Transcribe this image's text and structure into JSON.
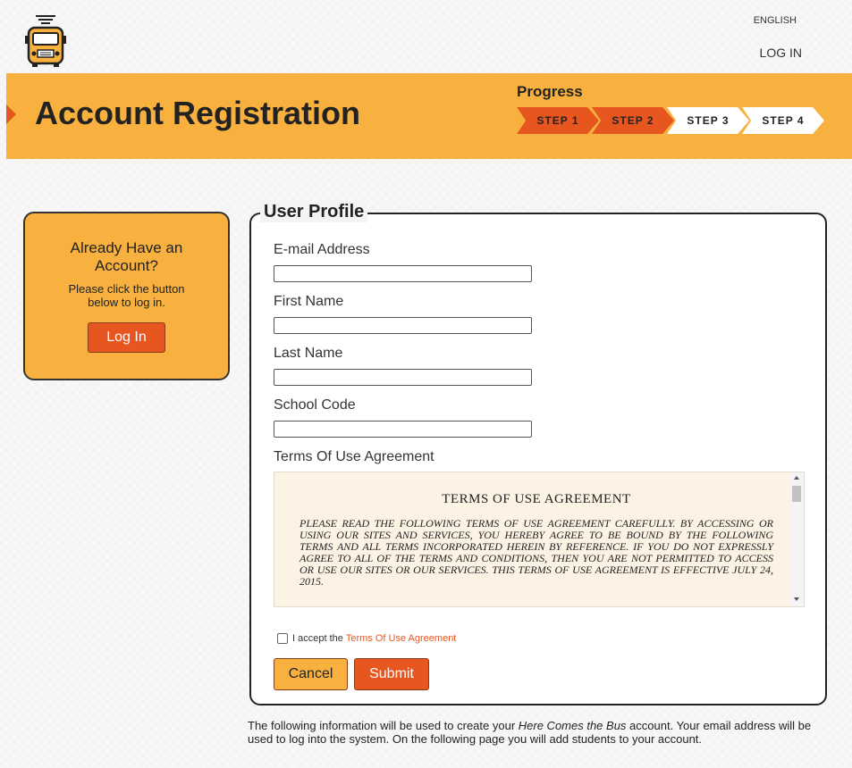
{
  "header": {
    "language": "ENGLISH",
    "login_link": "LOG IN"
  },
  "banner": {
    "title": "Account Registration",
    "progress_label": "Progress",
    "steps": [
      {
        "label": "STEP 1",
        "status": "done"
      },
      {
        "label": "STEP 2",
        "status": "done"
      },
      {
        "label": "STEP 3",
        "status": "todo"
      },
      {
        "label": "STEP 4",
        "status": "todo"
      }
    ]
  },
  "sidebox": {
    "heading": "Already Have an Account?",
    "text": "Please click the button below to log in.",
    "button": "Log In"
  },
  "form": {
    "legend": "User Profile",
    "fields": {
      "email": {
        "label": "E-mail Address",
        "value": ""
      },
      "first_name": {
        "label": "First Name",
        "value": ""
      },
      "last_name": {
        "label": "Last Name",
        "value": ""
      },
      "school_code": {
        "label": "School Code",
        "value": ""
      }
    },
    "terms_label": "Terms Of Use Agreement",
    "terms": {
      "title": "TERMS OF USE AGREEMENT",
      "body": "PLEASE READ THE FOLLOWING TERMS OF USE AGREEMENT CAREFULLY.  BY ACCESSING OR USING OUR SITES AND SERVICES, YOU HEREBY AGREE TO BE BOUND BY THE FOLLOWING TERMS AND ALL TERMS INCORPORATED HEREIN BY REFERENCE.  IF YOU DO NOT EXPRESSLY AGREE TO ALL OF THE TERMS AND CONDITIONS, THEN YOU ARE NOT PERMITTED TO ACCESS OR USE OUR SITES OR OUR SERVICES.  THIS TERMS OF USE AGREEMENT IS EFFECTIVE JULY 24, 2015."
    },
    "accept_prefix": "I accept the",
    "accept_link": "Terms Of Use Agreement",
    "cancel": "Cancel",
    "submit": "Submit"
  },
  "footer": {
    "before": "The following information will be used to create your ",
    "brand": "Here Comes the Bus",
    "after": " account. Your email address will be used to log into the system. On the following page you will add students to your account."
  },
  "colors": {
    "accent_orange": "#e8561f",
    "banner_yellow": "#f8b13e"
  },
  "icons": {
    "logo": "school-bus-icon"
  }
}
